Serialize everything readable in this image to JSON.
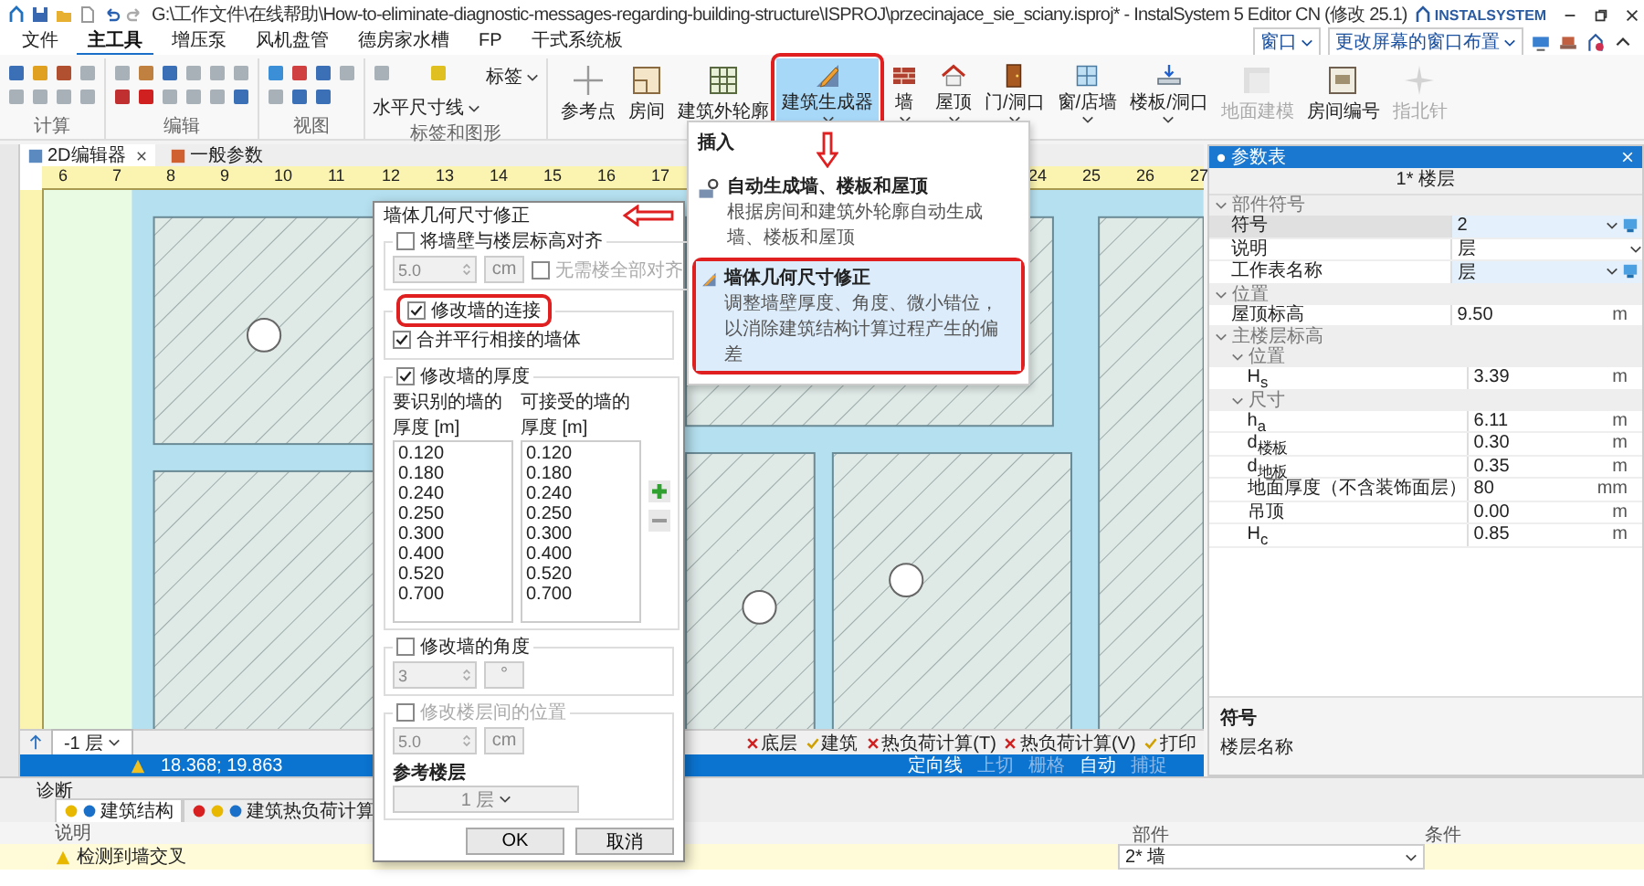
{
  "window": {
    "title": "G:\\工作文件\\在线帮助\\How-to-eliminate-diagnostic-messages-regarding-building-structure\\ISPROJ\\przecinajace_sie_sciany.isproj* - InstalSystem 5 Editor CN (修改 25.1)",
    "logo": "INSTALSYSTEM"
  },
  "menu": {
    "tabs": [
      {
        "label": "文件",
        "selected": false
      },
      {
        "label": "主工具",
        "selected": true
      },
      {
        "label": "增压泵",
        "selected": false
      },
      {
        "label": "风机盘管",
        "selected": false
      },
      {
        "label": "德房家水槽",
        "selected": false
      },
      {
        "label": "FP",
        "selected": false
      },
      {
        "label": "干式系统板",
        "selected": false
      }
    ],
    "window_dropdown": "窗口",
    "layout_dropdown": "更改屏幕的窗口布置"
  },
  "ribbon": {
    "groups": [
      {
        "label": "计算"
      },
      {
        "label": "编辑"
      },
      {
        "label": "视图"
      },
      {
        "label": "标签和图形",
        "buttons": [
          "标签",
          "水平尺寸线"
        ]
      }
    ],
    "buttons": [
      {
        "label": "参考点",
        "disabled": false,
        "dropdown": false,
        "selected": false
      },
      {
        "label": "房间",
        "disabled": false,
        "dropdown": false,
        "selected": false
      },
      {
        "label": "建筑外轮廓",
        "disabled": false,
        "dropdown": false,
        "selected": false
      },
      {
        "label": "建筑生成器",
        "disabled": false,
        "dropdown": true,
        "selected": true
      },
      {
        "label": "墙",
        "disabled": false,
        "dropdown": true,
        "selected": false
      },
      {
        "label": "屋顶",
        "disabled": false,
        "dropdown": true,
        "selected": false
      },
      {
        "label": "门/洞口",
        "disabled": false,
        "dropdown": true,
        "selected": false
      },
      {
        "label": "窗/店墙",
        "disabled": false,
        "dropdown": true,
        "selected": false
      },
      {
        "label": "楼板/洞口",
        "disabled": false,
        "dropdown": true,
        "selected": false
      },
      {
        "label": "地面建模",
        "disabled": true,
        "dropdown": false,
        "selected": false
      },
      {
        "label": "房间编号",
        "disabled": false,
        "dropdown": false,
        "selected": false
      },
      {
        "label": "指北针",
        "disabled": true,
        "dropdown": false,
        "selected": false
      }
    ]
  },
  "popup": {
    "header": "插入",
    "items": [
      {
        "title": "自动生成墙、楼板和屋顶",
        "description": "根据房间和建筑外轮廓自动生成墙、楼板和屋顶",
        "highlighted": false
      },
      {
        "title": "墙体几何尺寸修正",
        "description": "调整墙壁厚度、角度、微小错位，以消除建筑结构计算过程产生的偏差",
        "highlighted": true
      }
    ]
  },
  "doc_tabs": [
    {
      "label": "2D编辑器",
      "selected": true,
      "closable": true
    },
    {
      "label": "一般参数",
      "selected": false,
      "closable": false
    }
  ],
  "ruler": [
    "6",
    "7",
    "8",
    "9",
    "10",
    "11",
    "12",
    "13",
    "14",
    "15",
    "16",
    "17",
    "24",
    "25",
    "26",
    "27"
  ],
  "editor_toolbar": {
    "level": "-1 层",
    "buttons": [
      {
        "label": "底层",
        "active": false
      },
      {
        "label": "建筑",
        "active": true
      },
      {
        "label": "热负荷计算(T)",
        "active": false
      },
      {
        "label": "热负荷计算(V)",
        "active": false
      },
      {
        "label": "打印",
        "active": true
      }
    ]
  },
  "status_bar": {
    "coordinates": "18.368; 19.863",
    "items": [
      {
        "label": "定向线",
        "disabled": false
      },
      {
        "label": "上切",
        "disabled": true
      },
      {
        "label": "栅格",
        "disabled": true
      },
      {
        "label": "自动",
        "disabled": false
      },
      {
        "label": "捕捉",
        "disabled": true
      }
    ]
  },
  "properties": {
    "title": "参数表",
    "header": "1* 楼层",
    "rows": [
      {
        "kind": "section",
        "label": "部件符号",
        "children": [
          {
            "kind": "property",
            "label": "符号",
            "value": "2",
            "selected": true,
            "dropdown": true,
            "linked": true
          },
          {
            "kind": "property",
            "label": "说明",
            "value": "层",
            "selected": false,
            "dropdown": true,
            "linked": false
          },
          {
            "kind": "property",
            "label": "工作表名称",
            "value": "层",
            "selected": false,
            "dropdown": true,
            "linked": true
          }
        ]
      },
      {
        "kind": "section",
        "label": "位置",
        "children": [
          {
            "kind": "property",
            "label": "屋顶标高",
            "value": "9.50",
            "unit": "m",
            "selected": false,
            "dropdown": false,
            "linked": false
          }
        ]
      },
      {
        "kind": "section",
        "label": "主楼层标高",
        "children": [
          {
            "kind": "section",
            "label": "位置",
            "children": [
              {
                "kind": "property",
                "label": "H$_{s}$",
                "value": "3.39",
                "unit": "m",
                "selected": false,
                "dropdown": false,
                "linked": false
              }
            ]
          },
          {
            "kind": "section",
            "label": "尺寸",
            "children": [
              {
                "kind": "property",
                "label": "h$_{a}$",
                "value": "6.11",
                "unit": "m",
                "selected": false,
                "dropdown": false,
                "linked": false
              },
              {
                "kind": "property",
                "label": "d$_{楼板}$",
                "value": "0.30",
                "unit": "m",
                "selected": false,
                "dropdown": false,
                "linked": false
              },
              {
                "kind": "property",
                "label": "d$_{地板}$",
                "value": "0.35",
                "unit": "m",
                "selected": false,
                "dropdown": false,
                "linked": false
              },
              {
                "kind": "property",
                "label": "地面厚度（不含装饰面层）",
                "value": "80",
                "unit": "mm",
                "selected": false,
                "dropdown": false,
                "linked": false
              },
              {
                "kind": "property",
                "label": "吊顶",
                "value": "0.00",
                "unit": "m",
                "selected": false,
                "dropdown": false,
                "linked": false
              },
              {
                "kind": "property",
                "label": "H$_{c}$",
                "value": "0.85",
                "unit": "m",
                "selected": false,
                "dropdown": false,
                "linked": false
              }
            ]
          }
        ]
      }
    ],
    "footer": {
      "title": "符号",
      "description": "楼层名称"
    }
  },
  "dialog": {
    "title": "墙体几何尺寸修正",
    "align": {
      "label": "将墙壁与楼层标高对齐",
      "checked": false,
      "value": "5.0",
      "unit": "cm",
      "option": {
        "label": "无需楼全部对齐",
        "checked": false
      }
    },
    "connections": {
      "label": "修改墙的连接",
      "checked": true,
      "option": {
        "label": "合并平行相接的墙体",
        "checked": true
      }
    },
    "thickness": {
      "label": "修改墙的厚度",
      "checked": true,
      "recognized": {
        "header": "要识别的墙的厚度 [m]",
        "items": [
          "0.120",
          "0.180",
          "0.240",
          "0.250",
          "0.300",
          "0.400",
          "0.520",
          "0.700"
        ]
      },
      "accepted": {
        "header": "可接受的墙的厚度 [m]",
        "items": [
          "0.120",
          "0.180",
          "0.240",
          "0.250",
          "0.300",
          "0.400",
          "0.520",
          "0.700"
        ]
      }
    },
    "angle": {
      "label": "修改墙的角度",
      "checked": false,
      "value": "3",
      "unit": "°"
    },
    "level_position": {
      "label": "修改楼层间的位置",
      "checked": false,
      "value": "5.0",
      "unit": "cm",
      "reference_label": "参考楼层",
      "reference": "1 层"
    },
    "ok": "OK",
    "cancel": "取消"
  },
  "diagnostics": {
    "title": "诊断",
    "tabs": [
      {
        "label": "建筑结构",
        "selected": true,
        "error": false,
        "warning": true,
        "info": true
      },
      {
        "label": "建筑热负荷计算",
        "selected": false,
        "error": true,
        "warning": true,
        "info": true
      }
    ],
    "columns": [
      "说明",
      "部件",
      "条件"
    ],
    "rows": [
      {
        "warning": true,
        "description": "检测到墙交叉",
        "component": "2* 墙"
      }
    ]
  }
}
